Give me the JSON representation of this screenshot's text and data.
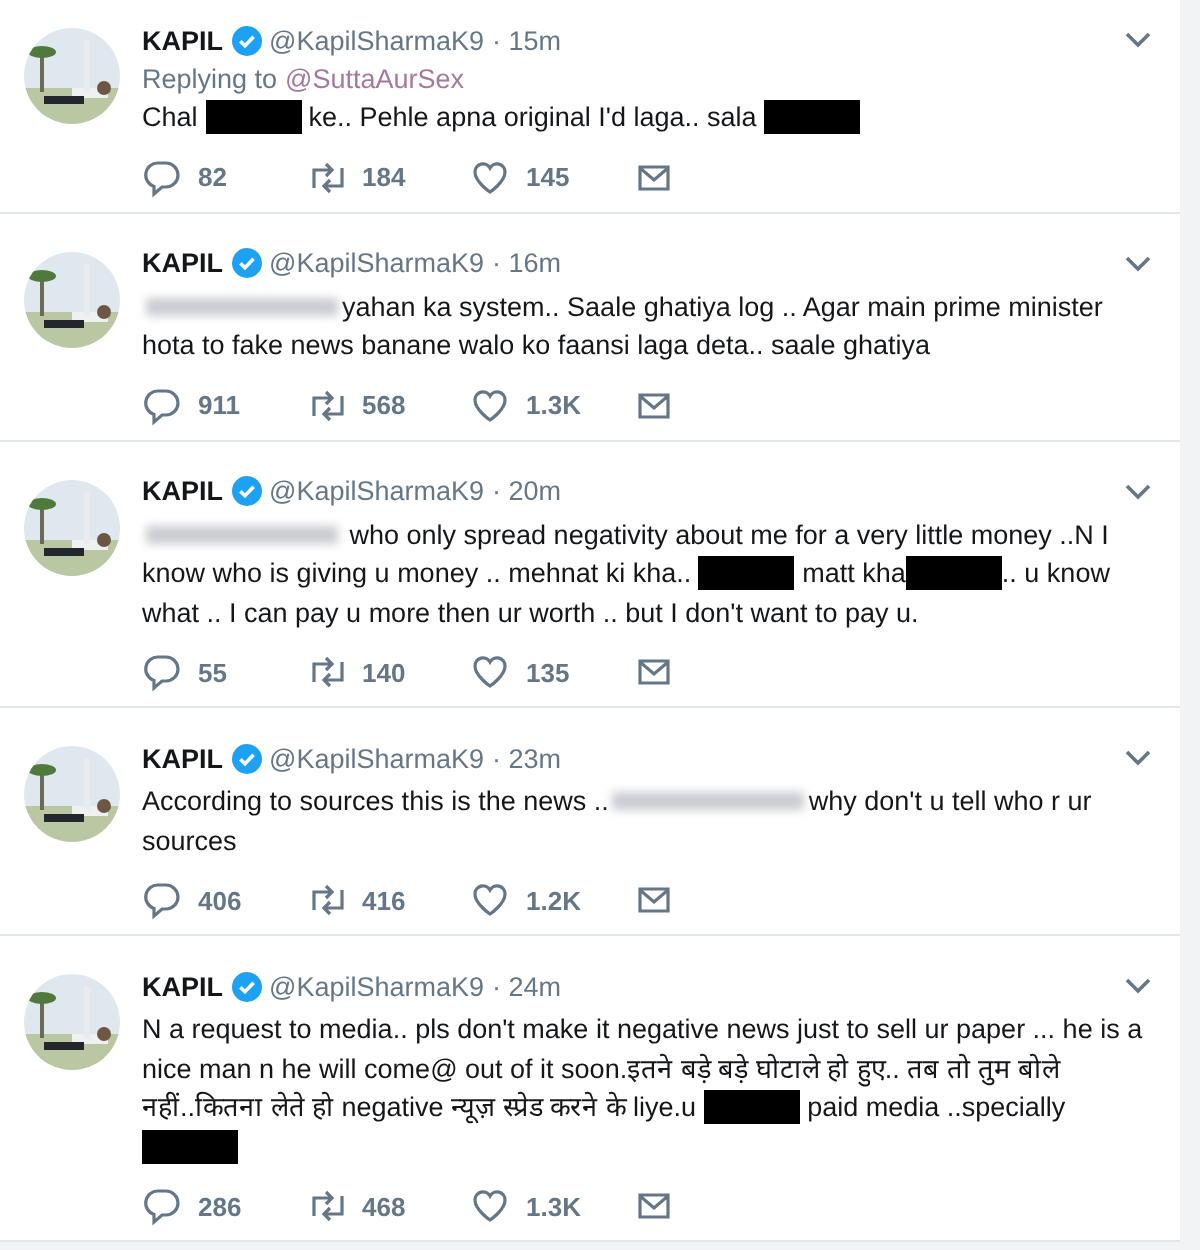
{
  "tweets": [
    {
      "name": "KAPIL",
      "verified": true,
      "handle": "@KapilSharmaK9",
      "time": "· 15m",
      "replying_to": {
        "label": "Replying to",
        "handle": "@SuttaAurSex"
      },
      "body": [
        {
          "kind": "text",
          "text": "Chal "
        },
        {
          "kind": "redacted"
        },
        {
          "kind": "text",
          "text": " ke.. Pehle apna original I'd laga.. sala "
        },
        {
          "kind": "redacted"
        }
      ],
      "replies": "82",
      "retweets": "184",
      "likes": "145"
    },
    {
      "name": "KAPIL",
      "verified": true,
      "handle": "@KapilSharmaK9",
      "time": "· 16m",
      "body": [
        {
          "kind": "blurred"
        },
        {
          "kind": "text",
          "text": "yahan ka system.. Saale ghatiya log .. Agar main prime minister hota to fake news banane walo ko faansi laga deta.. saale ghatiya"
        }
      ],
      "replies": "911",
      "retweets": "568",
      "likes": "1.3K"
    },
    {
      "name": "KAPIL",
      "verified": true,
      "handle": "@KapilSharmaK9",
      "time": "· 20m",
      "body": [
        {
          "kind": "blurred"
        },
        {
          "kind": "text",
          "text": " who only spread negativity about me for a very little money ..N I know who is giving u money .. mehnat ki kha.. "
        },
        {
          "kind": "redacted"
        },
        {
          "kind": "text",
          "text": " matt kha"
        },
        {
          "kind": "redacted"
        },
        {
          "kind": "text",
          "text": ".. u know what ..  I can pay u more then ur worth .. but I don't want to pay u."
        }
      ],
      "replies": "55",
      "retweets": "140",
      "likes": "135"
    },
    {
      "name": "KAPIL",
      "verified": true,
      "handle": "@KapilSharmaK9",
      "time": "· 23m",
      "body": [
        {
          "kind": "text",
          "text": "According to sources this is the news .."
        },
        {
          "kind": "blurred"
        },
        {
          "kind": "text",
          "text": "why don't u tell who r ur sources"
        }
      ],
      "replies": "406",
      "retweets": "416",
      "likes": "1.2K"
    },
    {
      "name": "KAPIL",
      "verified": true,
      "handle": "@KapilSharmaK9",
      "time": "· 24m",
      "body": [
        {
          "kind": "text",
          "text": "N a request to media.. pls don't make it negative news just to sell ur paper ... he is a nice man n he will come@ out of it soon.इतने बड़े बड़े घोटाले हो हुए.. तब तो तुम बोले नहीं..कितना लेते हो negative न्यूज़ स्प्रेड करने के liye.u "
        },
        {
          "kind": "redacted"
        },
        {
          "kind": "text",
          "text": " paid media ..specially "
        },
        {
          "kind": "redacted"
        }
      ],
      "replies": "286",
      "retweets": "468",
      "likes": "1.3K"
    }
  ]
}
